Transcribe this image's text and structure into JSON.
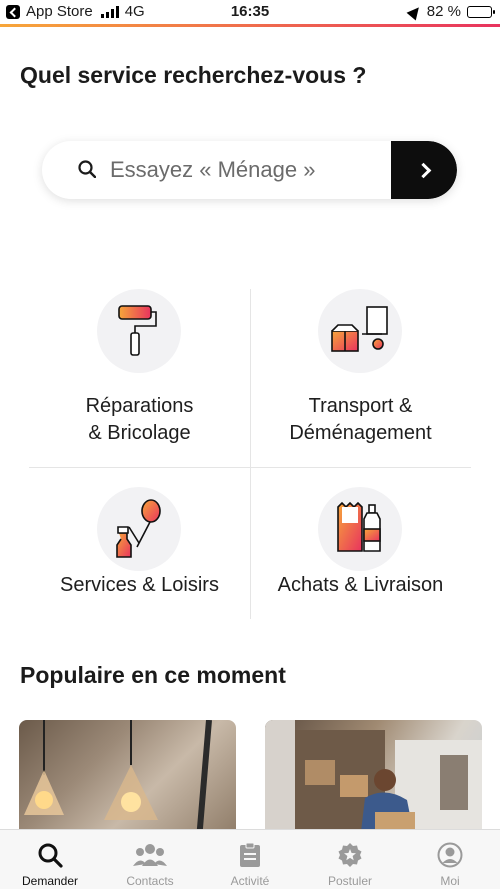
{
  "status_bar": {
    "carrier": "App Store",
    "network": "4G",
    "time": "16:35",
    "battery": "82 %",
    "battery_level": 0.82
  },
  "page": {
    "title": "Quel service recherchez-vous ?"
  },
  "search": {
    "placeholder": "Essayez « Ménage »"
  },
  "categories": [
    {
      "line1": "Réparations",
      "line2": "& Bricolage",
      "icon": "paint-roller-icon"
    },
    {
      "line1": "Transport &",
      "line2": "Déménagement",
      "icon": "moving-boxes-icon"
    },
    {
      "line1": "Services & Loisirs",
      "line2": "",
      "icon": "cleaning-balloon-icon"
    },
    {
      "line1": "Achats & Livraison",
      "line2": "",
      "icon": "grocery-bag-icon"
    }
  ],
  "popular": {
    "title": "Populaire en ce moment"
  },
  "tabs": [
    {
      "label": "Demander",
      "icon": "search-icon",
      "active": true
    },
    {
      "label": "Contacts",
      "icon": "users-icon",
      "active": false
    },
    {
      "label": "Activité",
      "icon": "clipboard-icon",
      "active": false
    },
    {
      "label": "Postuler",
      "icon": "star-badge-icon",
      "active": false
    },
    {
      "label": "Moi",
      "icon": "profile-icon",
      "active": false
    }
  ],
  "colors": {
    "accent_start": "#f7a63a",
    "accent_end": "#e8335e",
    "dark": "#0d0d0d"
  }
}
